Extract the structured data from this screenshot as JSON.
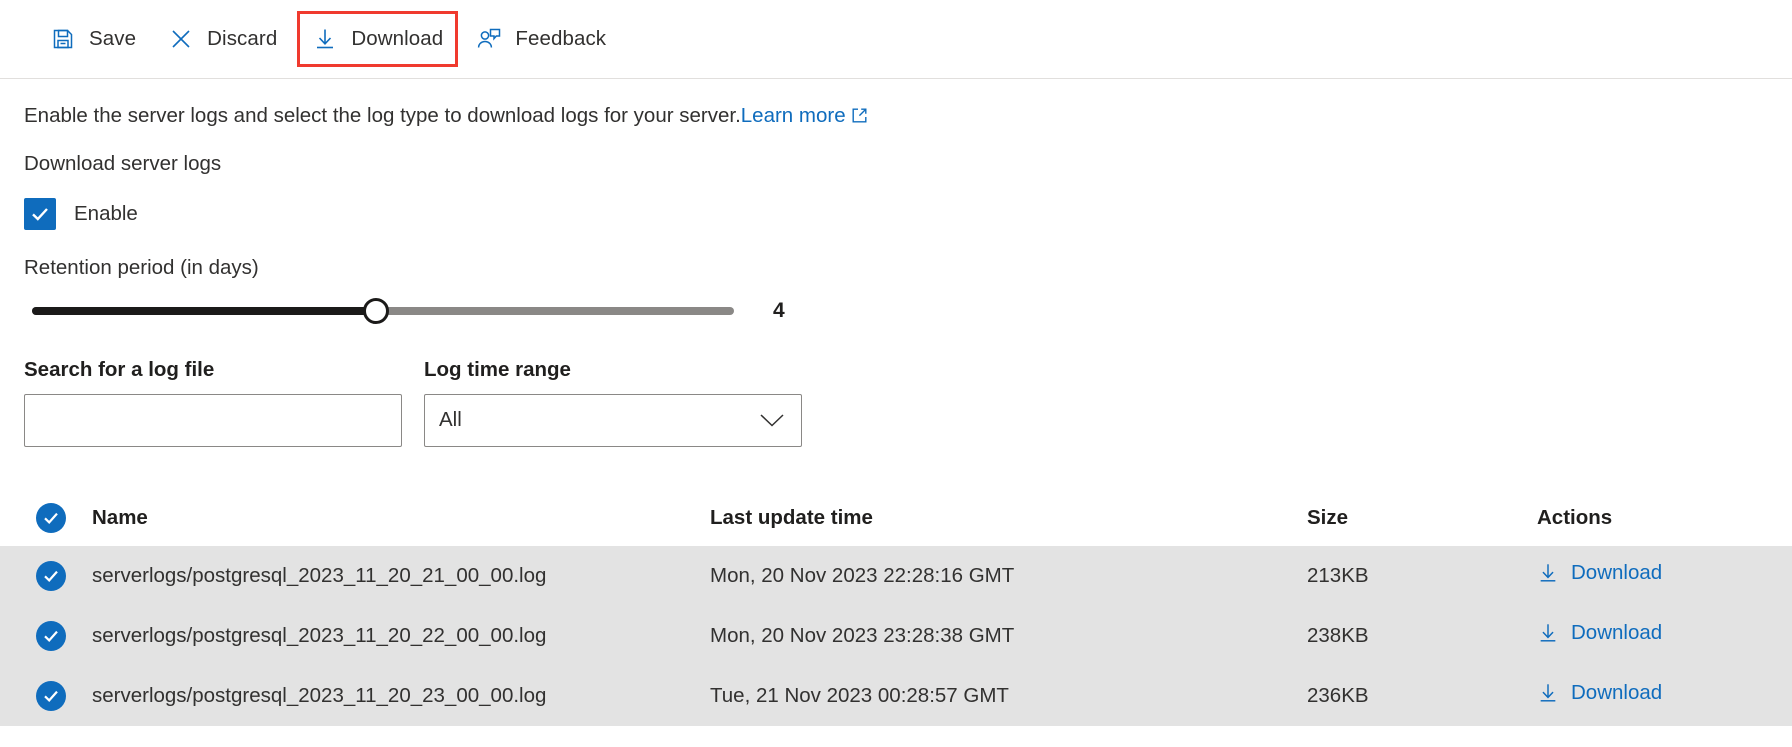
{
  "toolbar": {
    "items": [
      {
        "label": "Save",
        "icon": "save-icon",
        "highlighted": false
      },
      {
        "label": "Discard",
        "icon": "close-icon",
        "highlighted": false
      },
      {
        "label": "Download",
        "icon": "download-icon",
        "highlighted": true
      },
      {
        "label": "Feedback",
        "icon": "feedback-person-icon",
        "highlighted": false
      }
    ],
    "highlight_color": "#f03a2e"
  },
  "description": {
    "text": "Enable the server logs and select the log type to download logs for your server.",
    "link_label": "Learn more",
    "link_icon": "external-link-icon"
  },
  "section": {
    "title": "Download server logs"
  },
  "enable": {
    "label": "Enable",
    "checked": true,
    "icon": "checkmark-icon",
    "color": "#0f6cbd"
  },
  "retention": {
    "label": "Retention period (in days)",
    "value": "4",
    "min": 1,
    "max": 7,
    "fill_percent": 48
  },
  "filters": {
    "search": {
      "label": "Search for a log file",
      "value": "",
      "placeholder": ""
    },
    "time_range": {
      "label": "Log time range",
      "value": "All",
      "options": [
        "All"
      ],
      "chevron_icon": "chevron-down-icon"
    }
  },
  "table": {
    "select_all_checked": true,
    "columns": [
      "Name",
      "Last update time",
      "Size",
      "Actions"
    ],
    "action_label": "Download",
    "action_icon": "download-icon",
    "rows": [
      {
        "checked": true,
        "name": "serverlogs/postgresql_2023_11_20_21_00_00.log",
        "last_update_time": "Mon, 20 Nov 2023 22:28:16 GMT",
        "size": "213KB",
        "action": "Download"
      },
      {
        "checked": true,
        "name": "serverlogs/postgresql_2023_11_20_22_00_00.log",
        "last_update_time": "Mon, 20 Nov 2023 23:28:38 GMT",
        "size": "238KB",
        "action": "Download"
      },
      {
        "checked": true,
        "name": "serverlogs/postgresql_2023_11_20_23_00_00.log",
        "last_update_time": "Tue, 21 Nov 2023 00:28:57 GMT",
        "size": "236KB",
        "action": "Download"
      }
    ]
  }
}
